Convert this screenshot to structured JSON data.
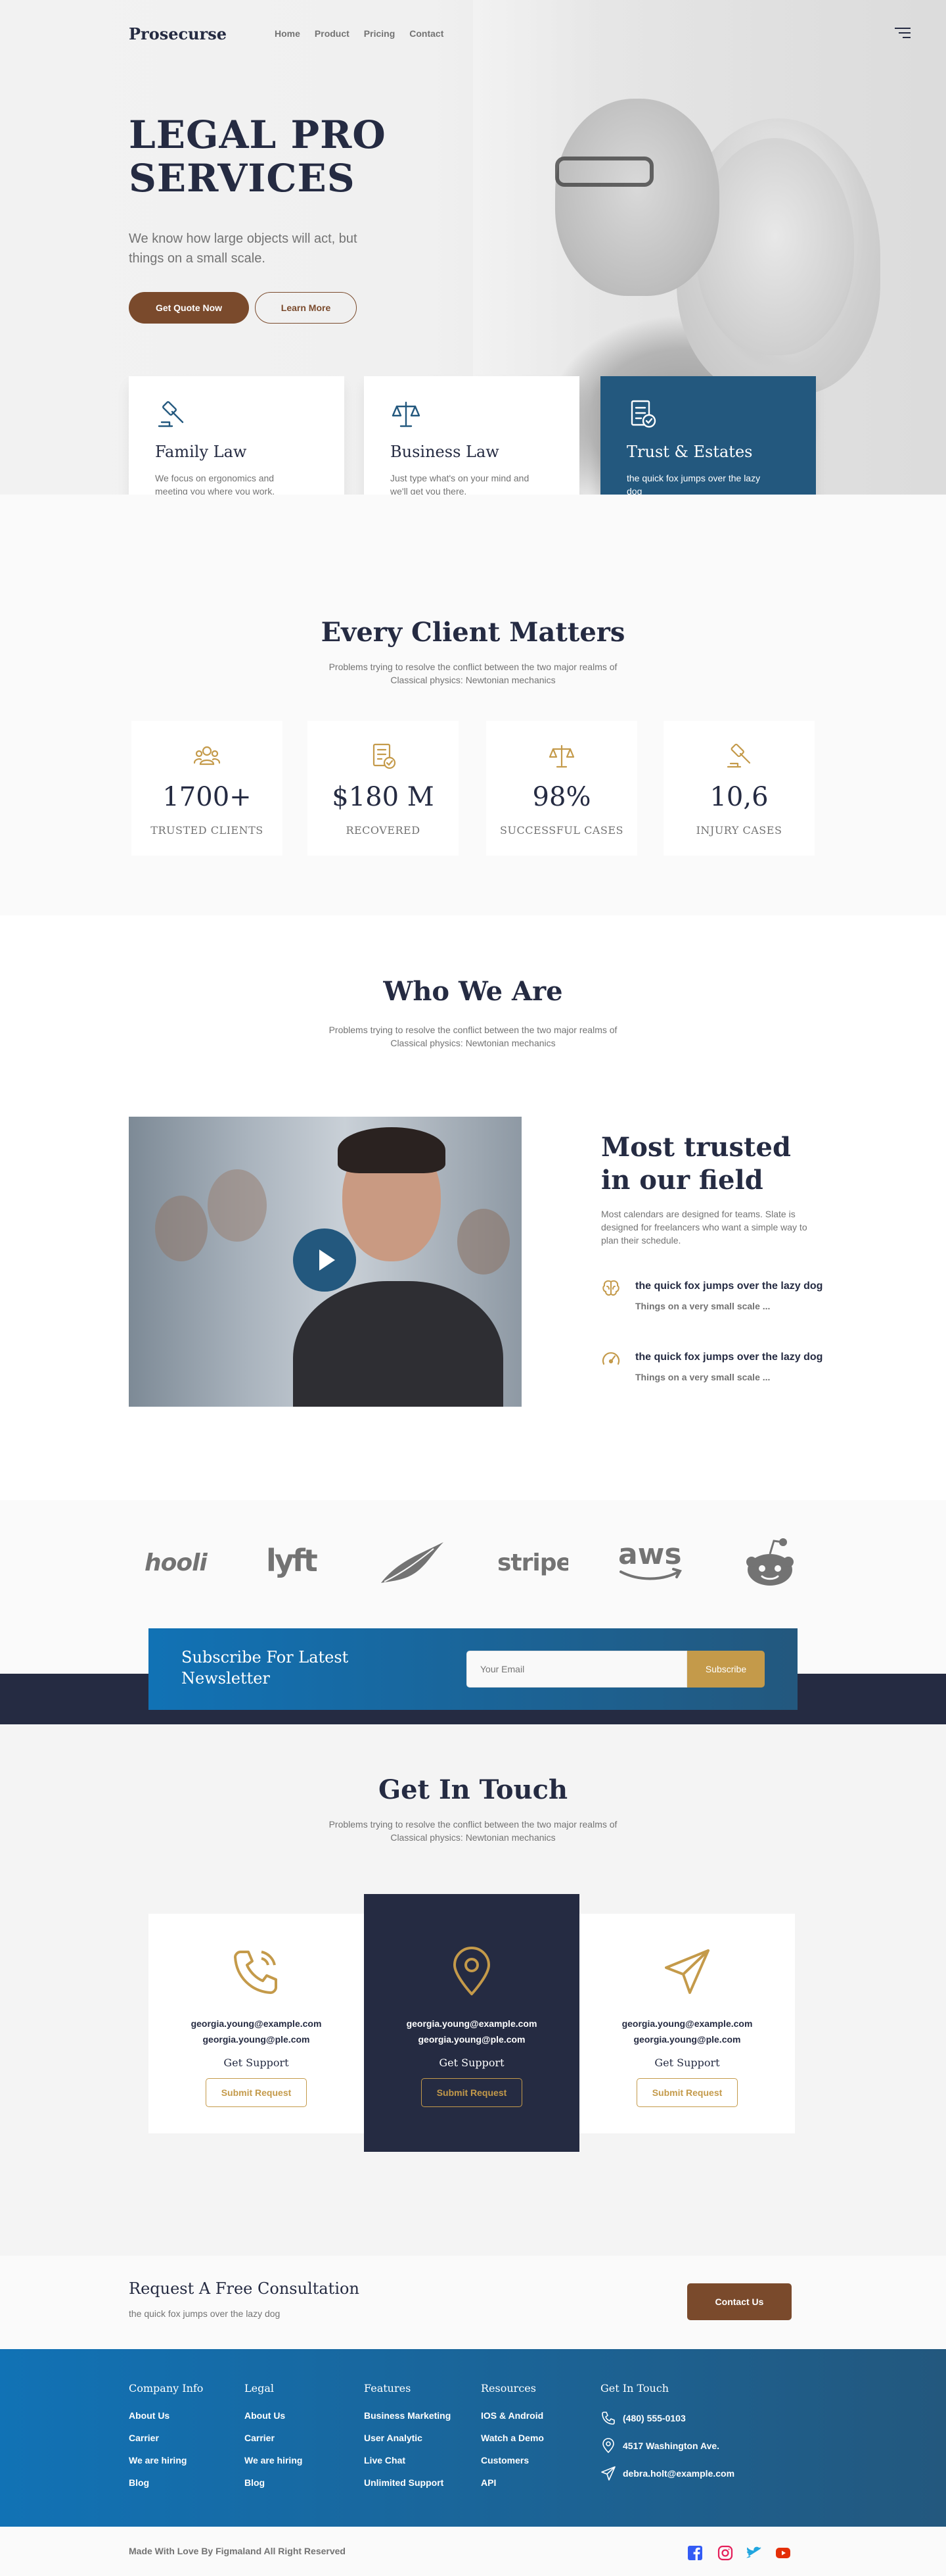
{
  "nav": {
    "logo": "Prosecurse",
    "links": [
      "Home",
      "Product",
      "Pricing",
      "Contact"
    ]
  },
  "hero": {
    "title": "LEGAL PRO SERVICES",
    "subtitle": "We know how large objects will act, but things on a small scale.",
    "primary_button": "Get Quote Now",
    "secondary_button": "Learn More"
  },
  "services": [
    {
      "title": "Family Law",
      "text": "We focus on ergonomics and meeting you where you work.",
      "icon": "gavel-icon"
    },
    {
      "title": "Business Law",
      "text": "Just type what's on your mind and we'll get you there.",
      "icon": "scales-icon"
    },
    {
      "title": "Trust & Estates",
      "text": "the quick fox jumps over the lazy dog",
      "icon": "document-check-icon"
    }
  ],
  "stats_section": {
    "title": "Every Client Matters",
    "subtitle": "Problems trying to resolve the conflict between the two major realms of Classical physics: Newtonian mechanics",
    "items": [
      {
        "value": "1700+",
        "label": "TRUSTED CLIENTS",
        "icon": "users-icon"
      },
      {
        "value": "$180 M",
        "label": "RECOVERED",
        "icon": "document-check-icon"
      },
      {
        "value": "98%",
        "label": "SUCCESSFUL CASES",
        "icon": "scales-icon"
      },
      {
        "value": "10,6",
        "label": "INJURY CASES",
        "icon": "gavel-icon"
      }
    ]
  },
  "who": {
    "title": "Who We Are",
    "subtitle": "Problems trying to resolve the conflict between the two major realms of Classical physics: Newtonian mechanics",
    "heading": "Most trusted in our field",
    "text": "Most calendars are designed for teams. Slate is designed for freelancers who want a simple way to plan their schedule.",
    "features": [
      {
        "title": "the quick fox jumps over the lazy dog",
        "text": "Things on a very small scale ...",
        "icon": "brain-icon"
      },
      {
        "title": "the quick fox jumps over the lazy dog",
        "text": "Things on a very small scale ...",
        "icon": "gauge-icon"
      }
    ]
  },
  "brands": [
    "hooli",
    "lyft",
    "leaf-logo",
    "stripe",
    "aws",
    "reddit"
  ],
  "newsletter": {
    "title": "Subscribe For Latest Newsletter",
    "placeholder": "Your Email",
    "button": "Subscribe"
  },
  "contact": {
    "title": "Get In Touch",
    "subtitle": "Problems trying to resolve the conflict between the two major realms of Classical physics: Newtonian mechanics",
    "cards": [
      {
        "email1": "georgia.young@example.com",
        "email2": "georgia.young@ple.com",
        "label": "Get Support",
        "button": "Submit Request",
        "icon": "phone-icon"
      },
      {
        "email1": "georgia.young@example.com",
        "email2": "georgia.young@ple.com",
        "label": "Get Support",
        "button": "Submit Request",
        "icon": "location-pin-icon"
      },
      {
        "email1": "georgia.young@example.com",
        "email2": "georgia.young@ple.com",
        "label": "Get Support",
        "button": "Submit Request",
        "icon": "send-icon"
      }
    ]
  },
  "cta": {
    "title": "Request A Free Consultation",
    "text": "the quick fox jumps over the lazy dog",
    "button": "Contact Us"
  },
  "footer": {
    "columns": [
      {
        "title": "Company Info",
        "links": [
          "About Us",
          "Carrier",
          "We are hiring",
          "Blog"
        ]
      },
      {
        "title": "Legal",
        "links": [
          "About Us",
          "Carrier",
          "We are hiring",
          "Blog"
        ]
      },
      {
        "title": "Features",
        "links": [
          "Business Marketing",
          "User Analytic",
          "Live Chat",
          "Unlimited Support"
        ]
      },
      {
        "title": "Resources",
        "links": [
          "IOS & Android",
          "Watch a Demo",
          "Customers",
          "API"
        ]
      }
    ],
    "touch": {
      "title": "Get In Touch",
      "phone": "(480) 555-0103",
      "address": "4517 Washington Ave.",
      "email": "debra.holt@example.com"
    },
    "copyright": "Made With Love By Figmaland All Right Reserved"
  },
  "colors": {
    "primary_dark": "#252B42",
    "accent_brown": "#7A4A2C",
    "accent_gold": "#C49A4A",
    "blue": "#23587E",
    "text_muted": "#737373"
  }
}
